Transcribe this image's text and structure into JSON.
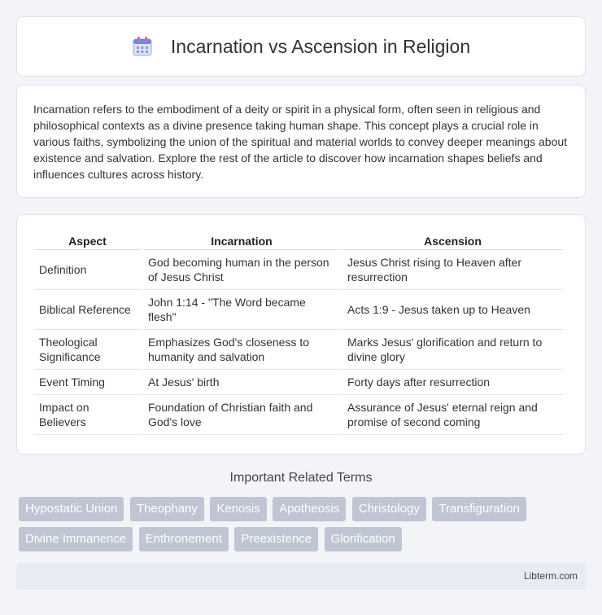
{
  "header": {
    "title": "Incarnation vs Ascension in Religion",
    "icon": "calendar-icon"
  },
  "intro": {
    "text": "Incarnation refers to the embodiment of a deity or spirit in a physical form, often seen in religious and philosophical contexts as a divine presence taking human shape. This concept plays a crucial role in various faiths, symbolizing the union of the spiritual and material worlds to convey deeper meanings about existence and salvation. Explore the rest of the article to discover how incarnation shapes beliefs and influences cultures across history."
  },
  "table": {
    "headers": [
      "Aspect",
      "Incarnation",
      "Ascension"
    ],
    "rows": [
      [
        "Definition",
        "God becoming human in the person of Jesus Christ",
        "Jesus Christ rising to Heaven after resurrection"
      ],
      [
        "Biblical Reference",
        "John 1:14 - \"The Word became flesh\"",
        "Acts 1:9 - Jesus taken up to Heaven"
      ],
      [
        "Theological Significance",
        "Emphasizes God's closeness to humanity and salvation",
        "Marks Jesus' glorification and return to divine glory"
      ],
      [
        "Event Timing",
        "At Jesus' birth",
        "Forty days after resurrection"
      ],
      [
        "Impact on Believers",
        "Foundation of Christian faith and God's love",
        "Assurance of Jesus' eternal reign and promise of second coming"
      ]
    ]
  },
  "related": {
    "title": "Important Related Terms",
    "tags": [
      "Hypostatic Union",
      "Theophany",
      "Kenosis",
      "Apotheosis",
      "Christology",
      "Transfiguration",
      "Divine Immanence",
      "Enthronement",
      "Preexistence",
      "Glorification"
    ]
  },
  "footer": {
    "text": "Libterm.com"
  }
}
